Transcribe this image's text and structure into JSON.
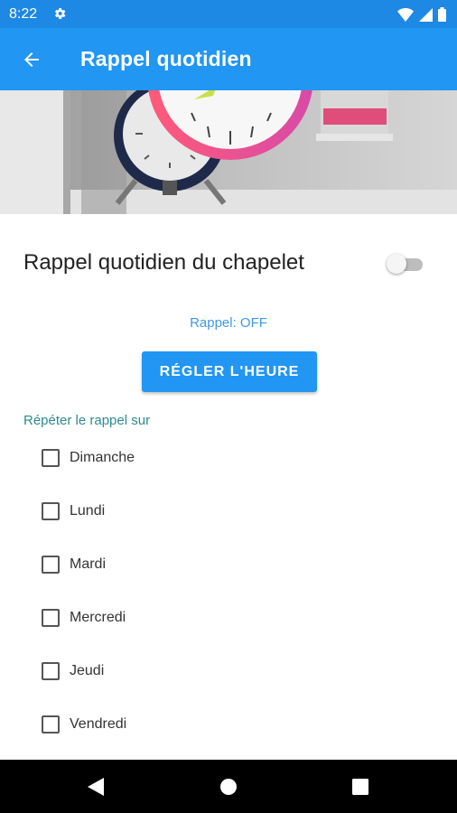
{
  "status_bar": {
    "time": "8:22",
    "icons": [
      "gear-icon",
      "wifi-icon",
      "signal-icon",
      "battery-icon"
    ]
  },
  "app_bar": {
    "title": "Rappel quotidien",
    "back_icon": "arrow-back-icon",
    "color": "#2196f3"
  },
  "reminder": {
    "title": "Rappel quotidien du chapelet",
    "toggle_on": false,
    "status": "Rappel: OFF",
    "set_time_label": "RÉGLER L'HEURE",
    "repeat_label": "Répéter le rappel sur"
  },
  "days": [
    {
      "label": "Dimanche",
      "checked": false
    },
    {
      "label": "Lundi",
      "checked": false
    },
    {
      "label": "Mardi",
      "checked": false
    },
    {
      "label": "Mercredi",
      "checked": false
    },
    {
      "label": "Jeudi",
      "checked": false
    },
    {
      "label": "Vendredi",
      "checked": false
    }
  ],
  "nav_bar": {
    "buttons": [
      "back-triangle-icon",
      "home-circle-icon",
      "recents-square-icon"
    ]
  },
  "colors": {
    "primary": "#2196f3",
    "status_bar": "#1e88e5",
    "status_text": "#3f98e5",
    "repeat_label": "#2e8b8b"
  }
}
